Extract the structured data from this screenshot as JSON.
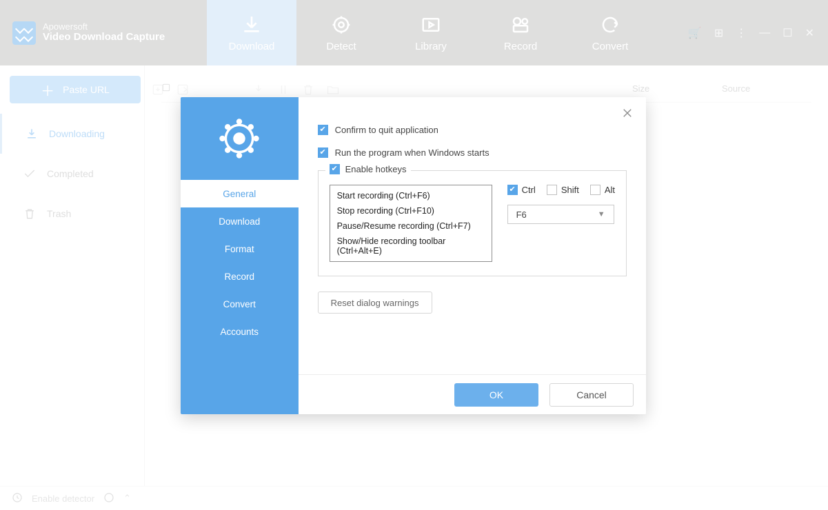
{
  "app": {
    "brand_top": "Apowersoft",
    "brand_main": "Video Download Capture"
  },
  "main_tabs": [
    {
      "label": "Download",
      "icon": "download-icon",
      "active": true
    },
    {
      "label": "Detect",
      "icon": "target-icon",
      "active": false
    },
    {
      "label": "Library",
      "icon": "play-square-icon",
      "active": false
    },
    {
      "label": "Record",
      "icon": "film-camera-icon",
      "active": false
    },
    {
      "label": "Convert",
      "icon": "cycle-icon",
      "active": false
    }
  ],
  "paste_button_label": "Paste URL",
  "sidebar": {
    "items": [
      {
        "label": "Downloading",
        "icon": "download-icon",
        "active": true
      },
      {
        "label": "Completed",
        "icon": "check-icon",
        "active": false
      },
      {
        "label": "Trash",
        "icon": "trash-icon",
        "active": false
      }
    ]
  },
  "columns": {
    "size": "Size",
    "source": "Source"
  },
  "status": {
    "enable_detector": "Enable detector"
  },
  "settings": {
    "nav": [
      {
        "label": "General",
        "active": true
      },
      {
        "label": "Download",
        "active": false
      },
      {
        "label": "Format",
        "active": false
      },
      {
        "label": "Record",
        "active": false
      },
      {
        "label": "Convert",
        "active": false
      },
      {
        "label": "Accounts",
        "active": false
      }
    ],
    "confirm_quit": {
      "label": "Confirm to quit application",
      "checked": true
    },
    "run_on_start": {
      "label": "Run the program when Windows starts",
      "checked": true
    },
    "enable_hotkeys": {
      "label": "Enable hotkeys",
      "checked": true
    },
    "hotkey_list": [
      "Start recording (Ctrl+F6)",
      "Stop recording (Ctrl+F10)",
      "Pause/Resume recording (Ctrl+F7)",
      "Show/Hide recording toolbar (Ctrl+Alt+E)"
    ],
    "modifiers": {
      "ctrl": {
        "label": "Ctrl",
        "checked": true
      },
      "shift": {
        "label": "Shift",
        "checked": false
      },
      "alt": {
        "label": "Alt",
        "checked": false
      }
    },
    "key_selected": "F6",
    "reset_label": "Reset dialog warnings",
    "ok_label": "OK",
    "cancel_label": "Cancel"
  }
}
